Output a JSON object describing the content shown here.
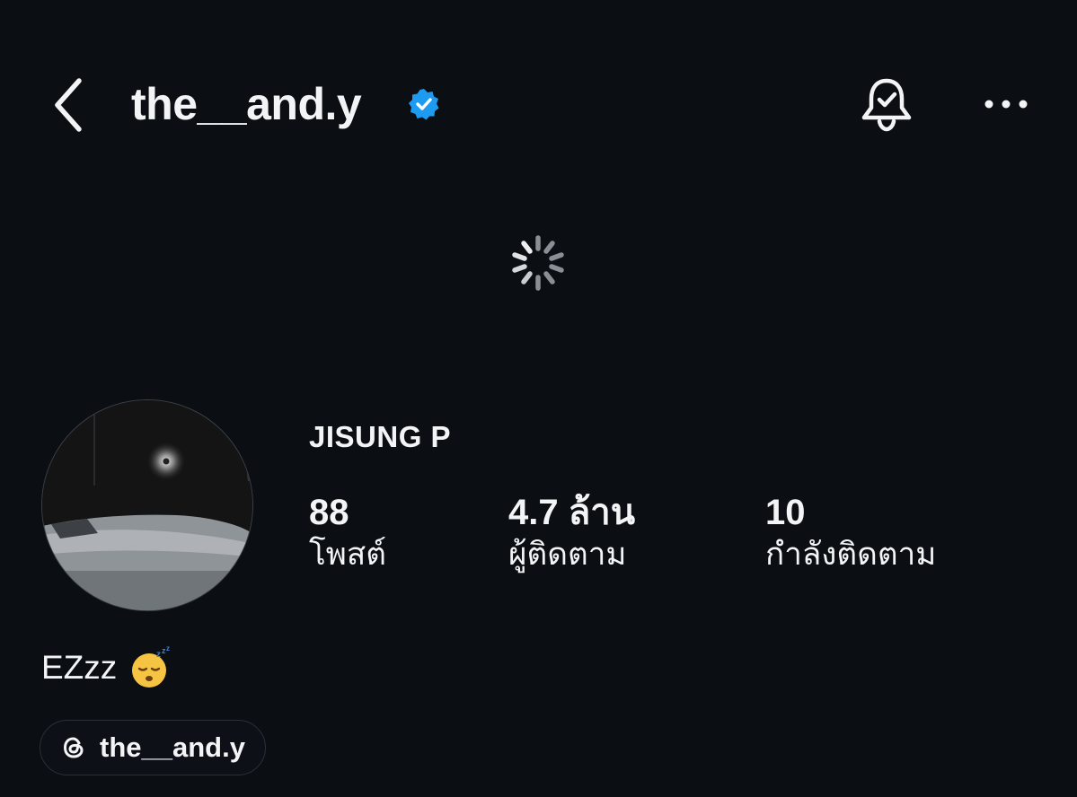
{
  "header": {
    "username": "the__and.y",
    "back_icon": "chevron-left-icon",
    "verified_icon": "verified-badge-icon",
    "bell_icon": "bell-check-icon",
    "more_icon": "more-horizontal-icon",
    "verified_color": "#1d9bf0"
  },
  "loading": {
    "icon": "loading-spinner-icon"
  },
  "profile": {
    "display_name": "JISUNG P",
    "stats": [
      {
        "value": "88",
        "label": "โพสต์"
      },
      {
        "value": "4.7 ล้าน",
        "label": "ผู้ติดตาม"
      },
      {
        "value": "10",
        "label": "กำลังติดตาม"
      }
    ],
    "bio": "EZzz",
    "bio_emoji": "sleeping-face-icon",
    "threads_handle": "the__and.y",
    "threads_icon": "threads-icon"
  },
  "colors": {
    "background": "#0b0f14",
    "text": "#f2f4f5",
    "accent": "#1d9bf0"
  }
}
